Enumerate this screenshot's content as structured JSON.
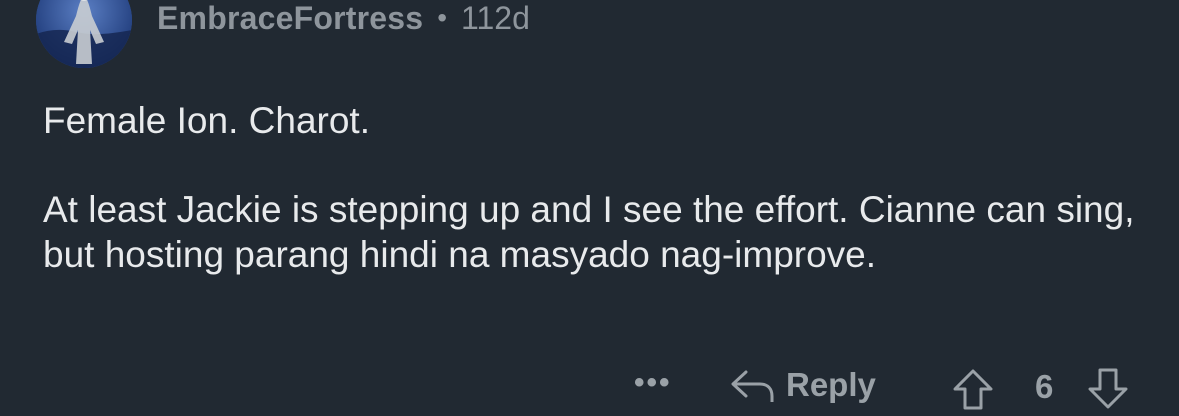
{
  "comment": {
    "username": "EmbraceFortress",
    "separator": "•",
    "age": "112d",
    "paragraphs": [
      "Female Ion. Charot.",
      "At least Jackie is stepping up and I see the effort. Cianne can sing, but hosting parang hindi na masyado nag-improve."
    ]
  },
  "actions": {
    "more_label": "•••",
    "reply_label": "Reply",
    "vote_count": "6",
    "icons": {
      "reply": "reply-arrow-icon",
      "upvote": "upvote-arrow-icon",
      "downvote": "downvote-arrow-icon",
      "more": "more-options-icon"
    }
  },
  "colors": {
    "background": "#212932",
    "text": "#e8eaec",
    "meta": "#8e959c",
    "action": "#9aa1a7"
  }
}
